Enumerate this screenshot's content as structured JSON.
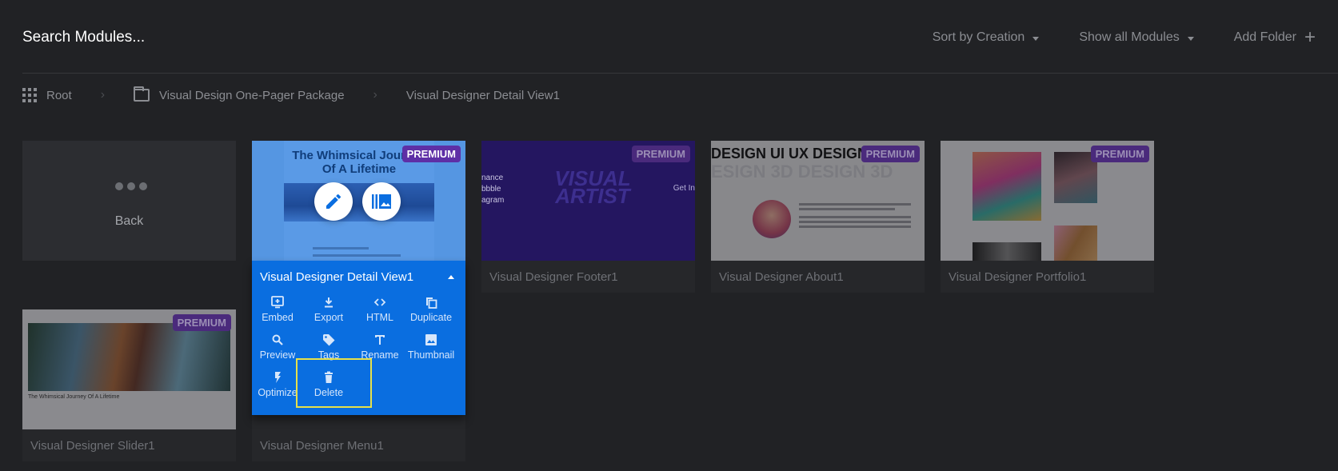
{
  "topbar": {
    "search_placeholder": "Search Modules...",
    "sort_label": "Sort by Creation",
    "filter_label": "Show all Modules",
    "add_folder_label": "Add Folder"
  },
  "breadcrumb": {
    "items": [
      {
        "label": "Root",
        "icon": "grid-icon"
      },
      {
        "label": "Visual Design One-Pager Package",
        "icon": "folder-icon"
      },
      {
        "label": "Visual Designer Detail View1"
      }
    ]
  },
  "back_card": {
    "label": "Back",
    "icon": "more-horizontal-icon"
  },
  "modules": [
    {
      "title": "Visual Designer Detail View1",
      "badge": "PREMIUM",
      "thumb_heading": "The Whimsical Journey Of A Lifetime",
      "active": true
    },
    {
      "title": "Visual Designer Footer1",
      "badge": "PREMIUM",
      "thumb_text": [
        "nance",
        "bbble",
        "agram"
      ],
      "thumb_heading": "VISUAL ARTIST",
      "thumb_side": "Get In"
    },
    {
      "title": "Visual Designer About1",
      "badge": "PREMIUM",
      "thumb_heading": "DESIGN UI UX DESIGN",
      "thumb_sub": "ESIGN 3D DESIGN 3D"
    },
    {
      "title": "Visual Designer Portfolio1",
      "badge": "PREMIUM"
    },
    {
      "title": "Visual Designer Slider1",
      "badge": "PREMIUM",
      "thumb_caption": "The Whimsical Journey Of A Lifetime"
    },
    {
      "title": "Visual Designer Menu1"
    }
  ],
  "active_panel": {
    "title": "Visual Designer Detail View1",
    "actions": [
      {
        "label": "Embed",
        "icon": "embed-icon"
      },
      {
        "label": "Export",
        "icon": "download-icon"
      },
      {
        "label": "HTML",
        "icon": "code-icon"
      },
      {
        "label": "Duplicate",
        "icon": "duplicate-icon"
      },
      {
        "label": "Preview",
        "icon": "search-icon"
      },
      {
        "label": "Tags",
        "icon": "tag-icon"
      },
      {
        "label": "Rename",
        "icon": "text-icon"
      },
      {
        "label": "Thumbnail",
        "icon": "image-icon"
      },
      {
        "label": "Optimize",
        "icon": "bolt-icon"
      },
      {
        "label": "Delete",
        "icon": "trash-icon"
      }
    ],
    "highlighted_action": "Delete"
  },
  "colors": {
    "accent": "#0a6ee0",
    "premium": "#5e2fa6",
    "highlight": "#e6e04a"
  }
}
